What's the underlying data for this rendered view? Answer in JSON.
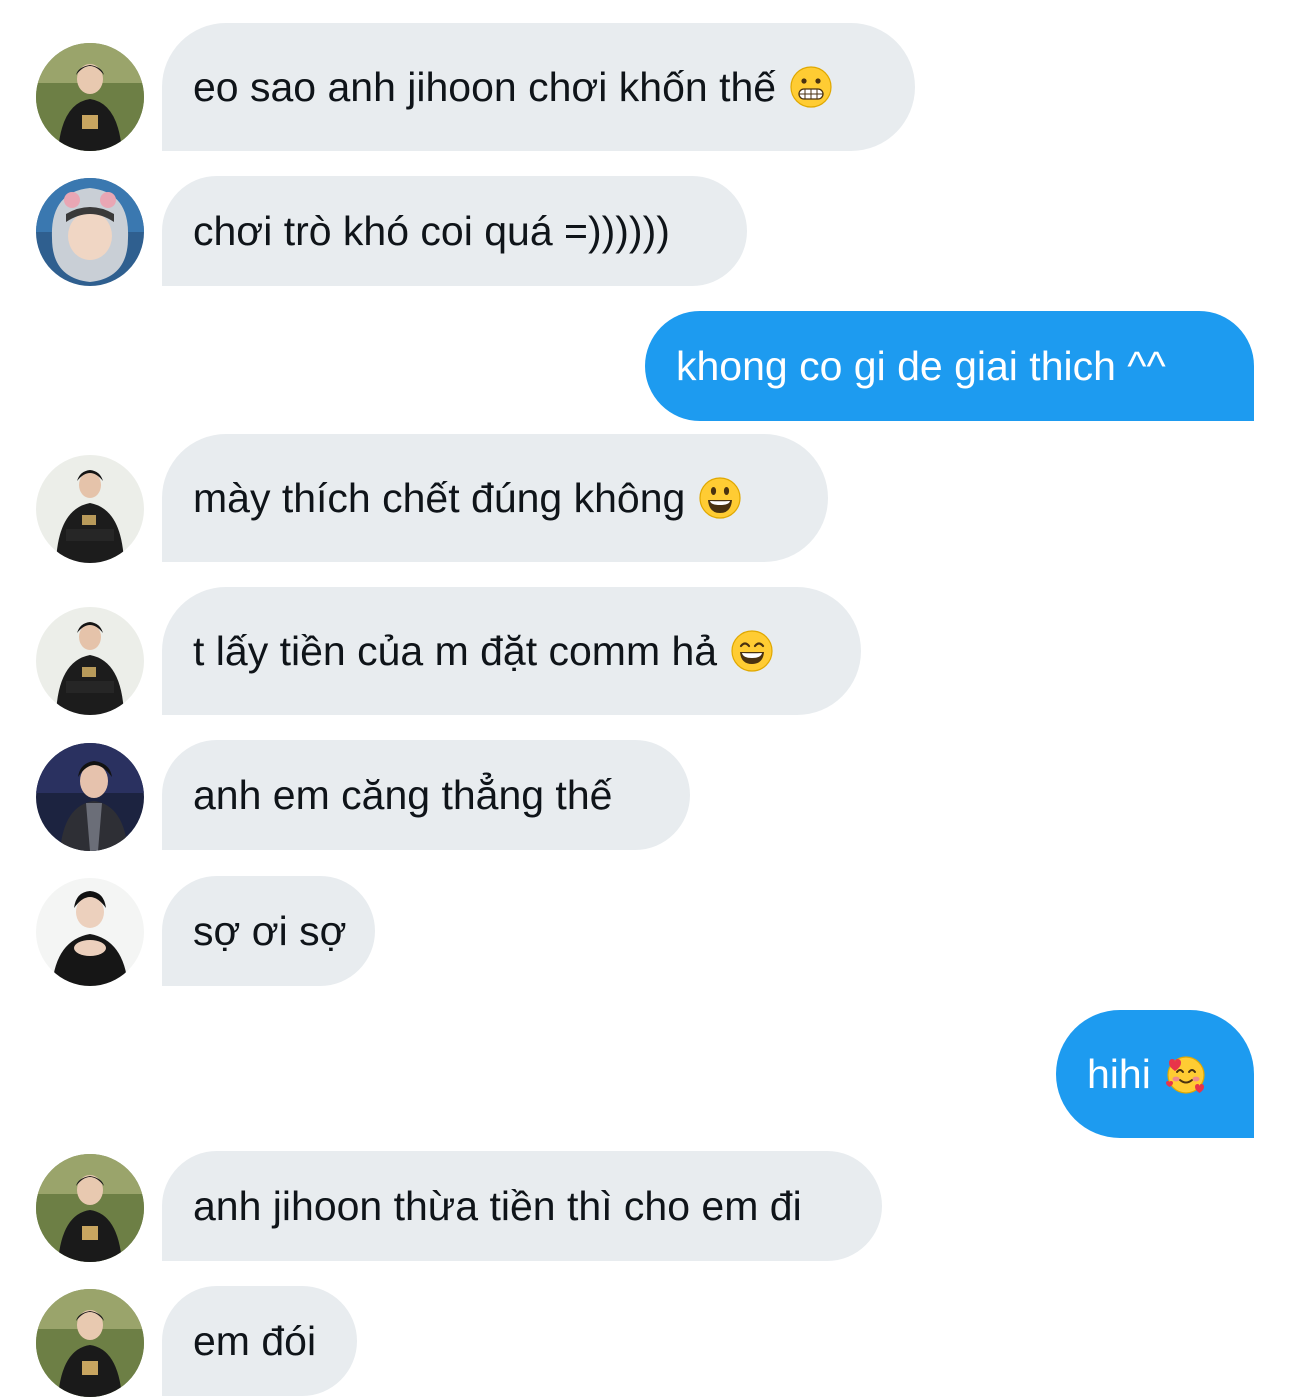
{
  "conversation": {
    "messages": [
      {
        "sender": "them",
        "text": "eo sao anh jihoon chơi khốn thế",
        "emoji": "grimacing-face-icon"
      },
      {
        "sender": "them",
        "text": "chơi trò khó coi quá =))))))"
      },
      {
        "sender": "me",
        "text": "khong co gi de giai thich ^^"
      },
      {
        "sender": "them",
        "text": "mày thích chết đúng không",
        "emoji": "grinning-face-icon"
      },
      {
        "sender": "them",
        "text": "t lấy tiền của m đặt comm hả",
        "emoji": "beaming-face-icon"
      },
      {
        "sender": "them",
        "text": "anh em căng thẳng thế"
      },
      {
        "sender": "them",
        "text": "sợ ơi sợ"
      },
      {
        "sender": "me",
        "text": "hihi",
        "emoji": "smiling-face-with-hearts-icon"
      },
      {
        "sender": "them",
        "text": "anh jihoon thừa tiền thì cho em đi"
      },
      {
        "sender": "them",
        "text": "em đói"
      }
    ]
  },
  "colors": {
    "incoming_bubble": "#e8ecef",
    "outgoing_bubble": "#1d9bf0",
    "incoming_text": "#0f1419",
    "outgoing_text": "#ffffff"
  }
}
